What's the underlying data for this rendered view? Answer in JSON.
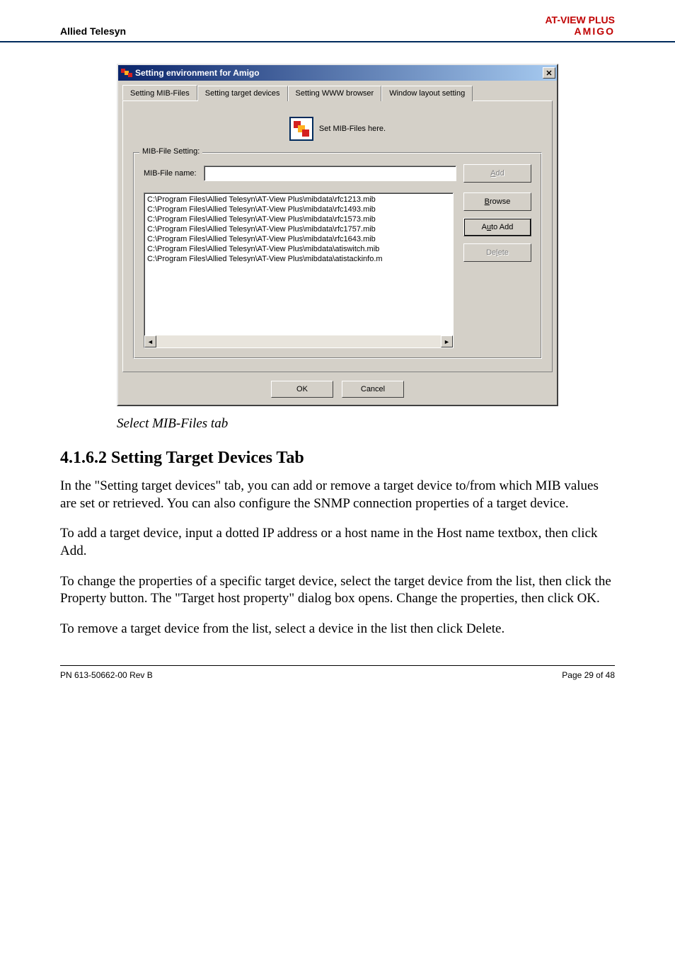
{
  "page_header": {
    "left": "Allied Telesyn",
    "right_top": "AT-VIEW PLUS",
    "right_bottom": "AMIGO"
  },
  "dialog": {
    "title": "Setting environment for Amigo",
    "tabs": [
      {
        "label": "Setting MIB-Files"
      },
      {
        "label": "Setting target devices"
      },
      {
        "label": "Setting WWW browser"
      },
      {
        "label": "Window layout setting"
      }
    ],
    "banner_text": "Set MIB-Files here.",
    "group_legend": "MIB-File Setting:",
    "mibfile_label": "MIB-File name:",
    "buttons": {
      "add": "Add",
      "browse": "Browse",
      "auto_add": "Auto Add",
      "delete": "Delete",
      "ok": "OK",
      "cancel": "Cancel"
    },
    "list_items": [
      "C:\\Program Files\\Allied Telesyn\\AT-View Plus\\mibdata\\rfc1213.mib",
      "C:\\Program Files\\Allied Telesyn\\AT-View Plus\\mibdata\\rfc1493.mib",
      "C:\\Program Files\\Allied Telesyn\\AT-View Plus\\mibdata\\rfc1573.mib",
      "C:\\Program Files\\Allied Telesyn\\AT-View Plus\\mibdata\\rfc1757.mib",
      "C:\\Program Files\\Allied Telesyn\\AT-View Plus\\mibdata\\rfc1643.mib",
      "C:\\Program Files\\Allied Telesyn\\AT-View Plus\\mibdata\\atiswitch.mib",
      "C:\\Program Files\\Allied Telesyn\\AT-View Plus\\mibdata\\atistackinfo.m"
    ]
  },
  "caption": "Select MIB-Files tab",
  "section": {
    "heading": "4.1.6.2 Setting Target Devices Tab",
    "p1": "In the \"Setting target devices\" tab, you can add or remove a target device to/from which MIB values are set or retrieved. You can also configure the SNMP connection properties of a target device.",
    "p2": "To add a target device, input a dotted IP address or a host name in the Host name textbox, then click Add.",
    "p3": "To change the properties of a specific target device, select the target device from the list, then click the Property button. The \"Target host property\" dialog box opens. Change the properties, then click OK.",
    "p4": "To remove a target device from the list, select a device in the list then click Delete."
  },
  "footer": {
    "left": "PN 613-50662-00 Rev B",
    "right": "Page 29 of 48"
  }
}
